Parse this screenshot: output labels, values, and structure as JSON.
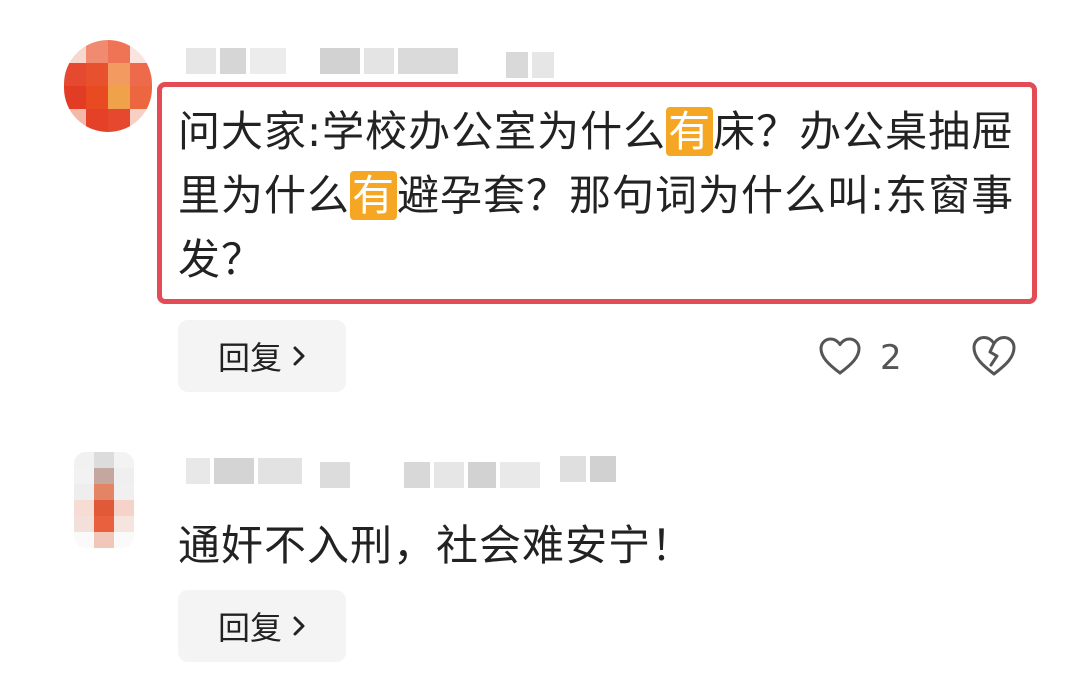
{
  "comments": [
    {
      "text_parts": [
        {
          "text": "问大家:学校办公室为什么"
        },
        {
          "text": "有",
          "highlight": true
        },
        {
          "text": "床？办公桌抽屉里为什么"
        },
        {
          "text": "有",
          "highlight": true
        },
        {
          "text": "避孕套？那句词为什么叫:东窗事发？"
        }
      ],
      "reply_label": "回复",
      "like_count": "2",
      "icons": {
        "like": "heart-outline-icon",
        "dislike": "broken-heart-icon",
        "reply_chevron": "chevron-right-icon"
      }
    },
    {
      "text": "通奸不入刑，社会难安宁！",
      "reply_label": "回复",
      "icons": {
        "reply_chevron": "chevron-right-icon"
      }
    }
  ],
  "colors": {
    "highlight_border": "#e34b55",
    "keyword_highlight": "#f5a623",
    "reply_button_bg": "#f4f4f4"
  }
}
